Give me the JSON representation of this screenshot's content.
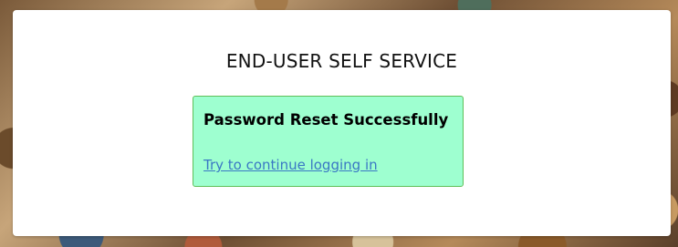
{
  "page": {
    "title": "END-USER SELF SERVICE"
  },
  "notice": {
    "heading": "Password Reset Successfully",
    "link_label": "Try to continue logging in"
  },
  "colors": {
    "notice_background": "#9effd0",
    "notice_border": "#5fbf58",
    "link": "#3a78c4"
  }
}
